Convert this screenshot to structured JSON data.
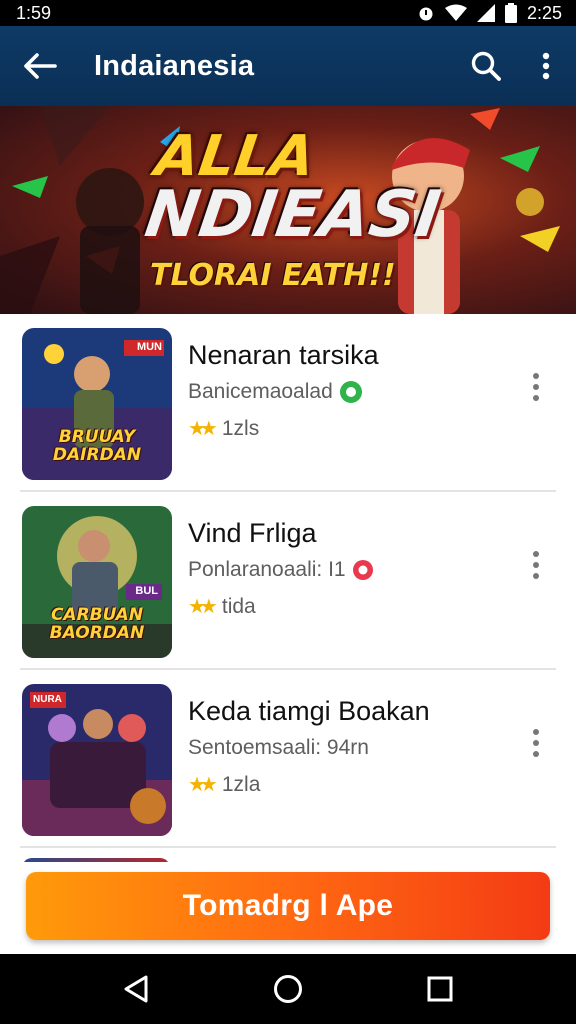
{
  "status_bar": {
    "time": "1:59",
    "right_time": "2:25"
  },
  "app_bar": {
    "title": "Indaianesia",
    "back_icon": "arrow-left-icon",
    "search_icon": "search-icon",
    "more_icon": "more-vertical-icon"
  },
  "banner": {
    "line1": "ALLA",
    "line2": "NDIEASI",
    "line3": "TLORAI EATH!!"
  },
  "items": [
    {
      "title": "Nenaran tarsika",
      "subtitle": "Banicemaoalad",
      "badge_color": "#2fb34a",
      "rating_text": "1zls",
      "thumb_badge": "MUN",
      "thumb_caption_1": "BRUUAY",
      "thumb_caption_2": "DAIRDAN"
    },
    {
      "title": "Vind Frliga",
      "subtitle": "Ponlaranoaali: I1",
      "badge_color": "#e8394e",
      "rating_text": "tida",
      "thumb_badge": "BUL",
      "thumb_caption_1": "CARBUAN",
      "thumb_caption_2": "BAORDAN"
    },
    {
      "title": "Keda tiamgi Boakan",
      "subtitle": "Sentoemsaali: 94rn",
      "badge_color": "#e8394e",
      "rating_text": "1zla",
      "thumb_badge": "NURA",
      "thumb_caption_1": "",
      "thumb_caption_2": ""
    }
  ],
  "cta": {
    "label": "Tomadrg l Ape"
  },
  "nav": {
    "back": "nav-back-icon",
    "home": "nav-home-icon",
    "recents": "nav-recents-icon"
  },
  "colors": {
    "app_bar": "#0a2f55",
    "cta_start": "#ff9a0a",
    "cta_end": "#f43b14",
    "star": "#f3b300"
  }
}
